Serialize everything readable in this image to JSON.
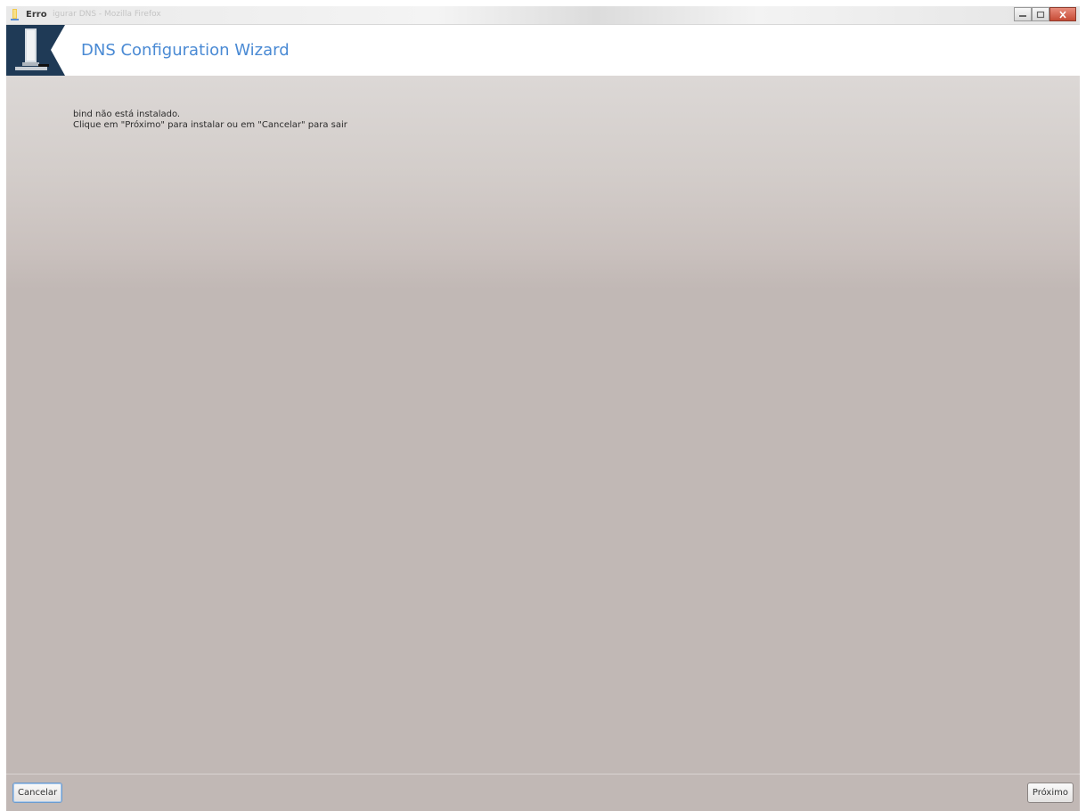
{
  "window": {
    "title": "Erro",
    "title_faded": "igurar DNS - Mozilla Firefox",
    "controls": {
      "minimize_icon": "minimize-icon",
      "maximize_icon": "maximize-icon",
      "close_icon": "close-icon"
    }
  },
  "header": {
    "title": "DNS Configuration Wizard",
    "title_color": "#4a8ad4",
    "logo_icon": "server-tower-icon"
  },
  "message": {
    "line1": "bind não está instalado.",
    "line2": "Clique em \"Próximo\" para instalar ou em \"Cancelar\" para sair"
  },
  "footer": {
    "cancel_label": "Cancelar",
    "next_label": "Próximo"
  }
}
